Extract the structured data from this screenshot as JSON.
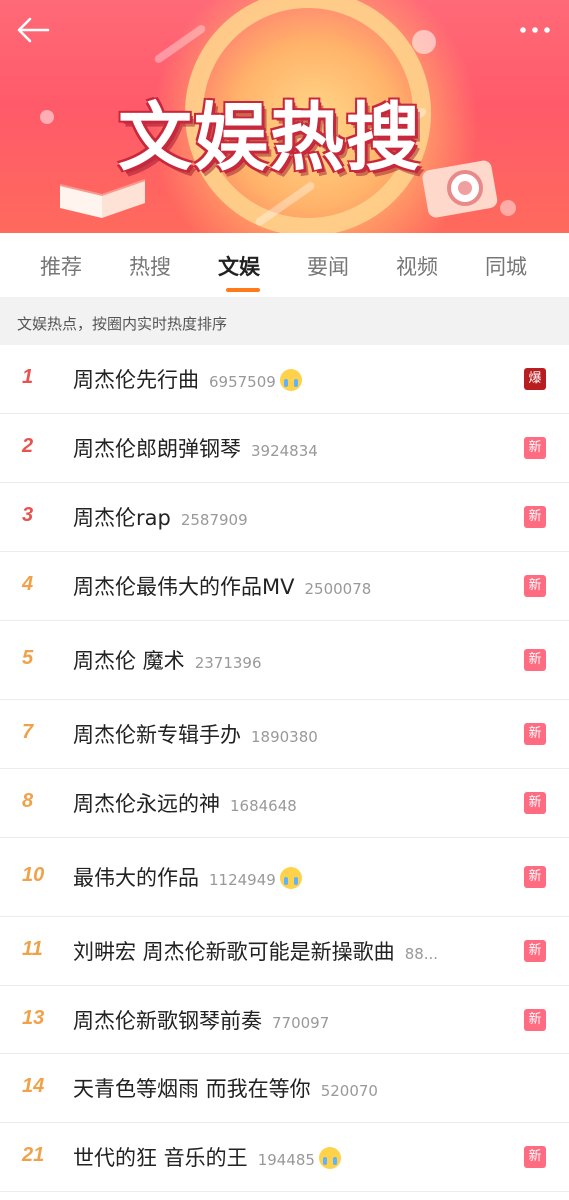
{
  "banner": {
    "title": "文娱热搜"
  },
  "tabs": [
    {
      "label": "推荐",
      "active": false
    },
    {
      "label": "热搜",
      "active": false
    },
    {
      "label": "文娱",
      "active": true
    },
    {
      "label": "要闻",
      "active": false
    },
    {
      "label": "视频",
      "active": false
    },
    {
      "label": "同城",
      "active": false
    }
  ],
  "subheading": "文娱热点，按圈内实时热度排序",
  "colors": {
    "rank_top": "#e8534f",
    "rank_other": "#f0a24a",
    "badge_new": "#ff6b81",
    "badge_hot": "#b81d20",
    "tab_underline": "#ff7a1a"
  },
  "items": [
    {
      "rank": "1",
      "title": "周杰伦先行曲",
      "count": "6957509",
      "emoji": "crying-face-icon",
      "badge": "爆"
    },
    {
      "rank": "2",
      "title": "周杰伦郎朗弹钢琴",
      "count": "3924834",
      "emoji": "",
      "badge": "新"
    },
    {
      "rank": "3",
      "title": "周杰伦rap",
      "count": "2587909",
      "emoji": "",
      "badge": "新"
    },
    {
      "rank": "4",
      "title": "周杰伦最伟大的作品MV",
      "count": "2500078",
      "emoji": "",
      "badge": "新"
    },
    {
      "rank": "5",
      "title": "周杰伦 魔术",
      "count": "2371396",
      "emoji": "",
      "badge": "新"
    },
    {
      "rank": "7",
      "title": "周杰伦新专辑手办",
      "count": "1890380",
      "emoji": "",
      "badge": "新"
    },
    {
      "rank": "8",
      "title": "周杰伦永远的神",
      "count": "1684648",
      "emoji": "",
      "badge": "新"
    },
    {
      "rank": "10",
      "title": "最伟大的作品",
      "count": "1124949",
      "emoji": "crying-face-icon",
      "badge": "新"
    },
    {
      "rank": "11",
      "title": "刘畊宏 周杰伦新歌可能是新操歌曲",
      "count": "88...",
      "emoji": "",
      "badge": "新"
    },
    {
      "rank": "13",
      "title": "周杰伦新歌钢琴前奏",
      "count": "770097",
      "emoji": "",
      "badge": "新"
    },
    {
      "rank": "14",
      "title": "天青色等烟雨 而我在等你",
      "count": "520070",
      "emoji": "",
      "badge": ""
    },
    {
      "rank": "21",
      "title": "世代的狂 音乐的王",
      "count": "194485",
      "emoji": "crying-face-icon",
      "badge": "新"
    }
  ]
}
